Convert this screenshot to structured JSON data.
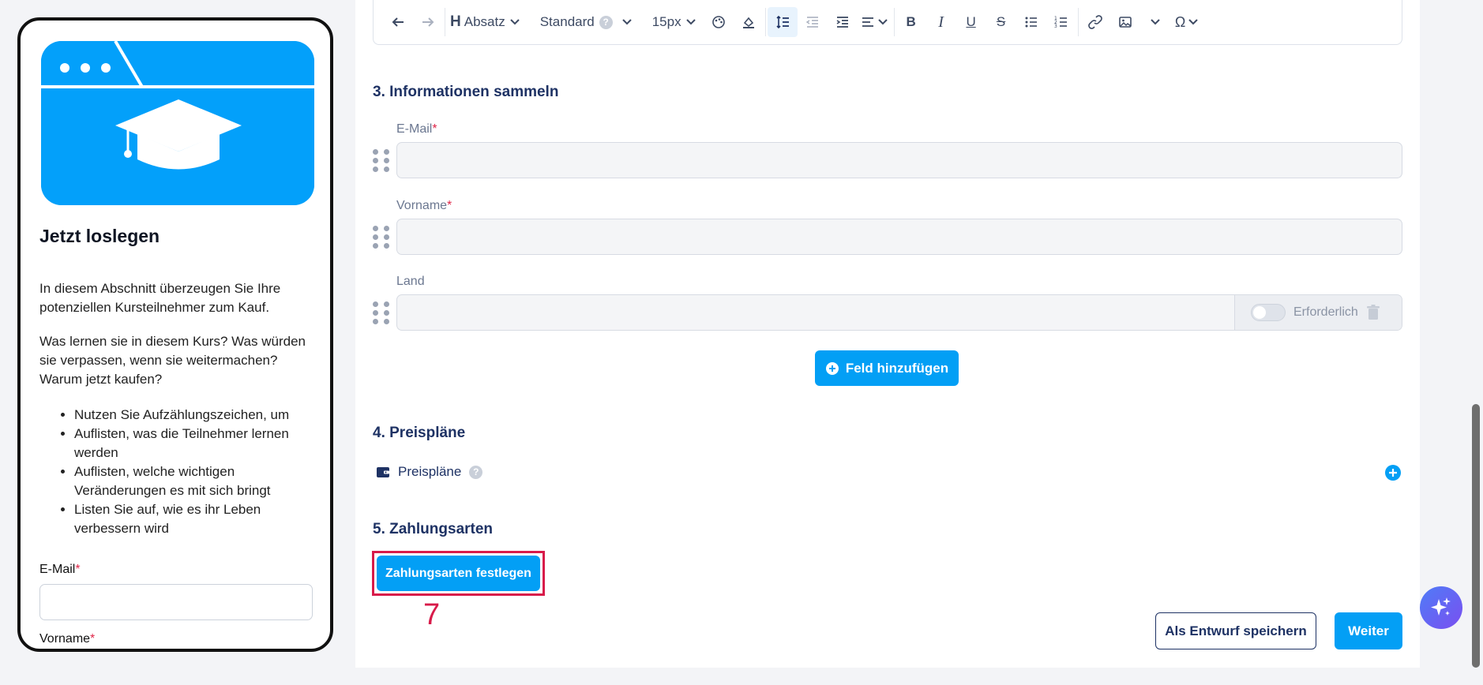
{
  "preview": {
    "title": "Jetzt loslegen",
    "para1": "In diesem Abschnitt überzeugen Sie Ihre potenziellen Kursteilnehmer zum Kauf.",
    "para2": "Was lernen sie in diesem Kurs? Was würden sie verpassen, wenn sie weitermachen? Warum jetzt kaufen?",
    "bullets": [
      "Nutzen Sie Aufzählungszeichen, um",
      "Auflisten, was die Teilnehmer lernen werden",
      "Auflisten, welche wichtigen Veränderungen es mit sich bringt",
      "Listen Sie auf, wie es ihr Leben verbessern wird"
    ],
    "email_label": "E-Mail",
    "firstname_label": "Vorname",
    "required_mark": "*"
  },
  "toolbar": {
    "heading_label": "Absatz",
    "font_label": "Standard",
    "font_help": "?",
    "size_label": "15px"
  },
  "section3": {
    "title": "3. Informationen sammeln",
    "fields": [
      {
        "label": "E-Mail",
        "required": true
      },
      {
        "label": "Vorname",
        "required": true
      },
      {
        "label": "Land",
        "required": false
      }
    ],
    "required_toggle_label": "Erforderlich",
    "add_field_label": "Feld hinzufügen"
  },
  "section4": {
    "title": "4. Preispläne",
    "item_label": "Preispläne",
    "help": "?"
  },
  "section5": {
    "title": "5. Zahlungsarten",
    "button_label": "Zahlungsarten festlegen",
    "annotation_number": "7"
  },
  "footer": {
    "draft_label": "Als Entwurf speichern",
    "next_label": "Weiter"
  },
  "colors": {
    "accent": "#039ff5",
    "heading": "#1e3264",
    "highlight_box": "#d81b4a"
  }
}
